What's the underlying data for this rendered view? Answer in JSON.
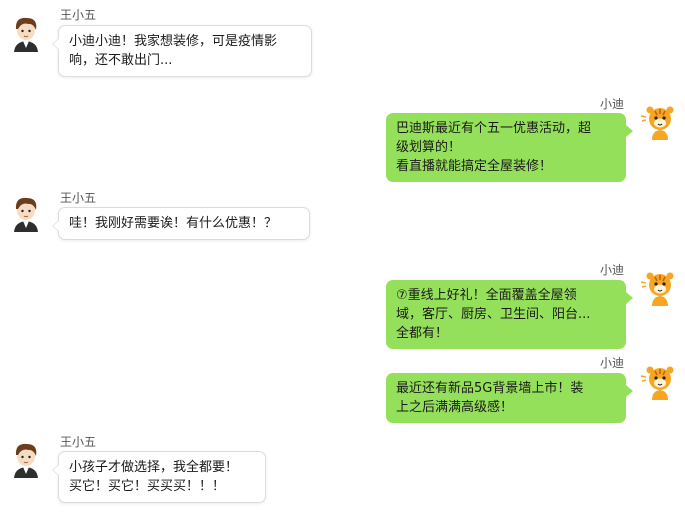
{
  "chat": {
    "messages": [
      {
        "sender": "王小五",
        "side": "left",
        "text": "小迪小迪！我家想装修，可是疫情影\n响，还不敢出门..."
      },
      {
        "sender": "小迪",
        "side": "right",
        "text": "巴迪斯最近有个五一优惠活动，超\n级划算的！\n看直播就能搞定全屋装修！"
      },
      {
        "sender": "王小五",
        "side": "left",
        "text": "哇！我刚好需要诶！有什么优惠！？"
      },
      {
        "sender": "小迪",
        "side": "right",
        "text": "⑦重线上好礼！全面覆盖全屋领\n域，客厅、厨房、卫生间、阳台...\n全都有！"
      },
      {
        "sender": "小迪",
        "side": "right",
        "text": "最近还有新品5G背景墙上市！装\n上之后满满高级感！"
      },
      {
        "sender": "王小五",
        "side": "left",
        "text": "小孩子才做选择，我全都要！\n买它！买它！买买买！！！"
      }
    ],
    "avatars": {
      "left": "boy-avatar-icon",
      "right": "tiger-mascot-icon"
    }
  }
}
